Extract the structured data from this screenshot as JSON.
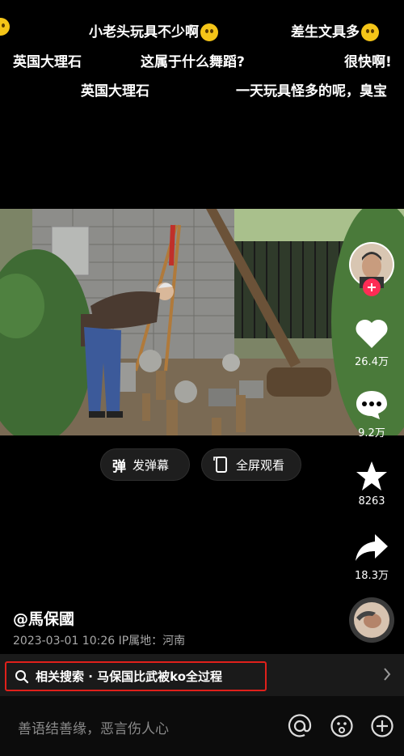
{
  "danmaku": {
    "row1_a": "小老头玩具不少啊",
    "row1_b": "差生文具多",
    "row2_a": "英国大理石",
    "row2_b": "这属于什么舞蹈?",
    "row2_c": "很快啊!",
    "row3_a": "英国大理石",
    "row3_b": "一天玩具怪多的呢，臭宝"
  },
  "side": {
    "likes": "26.4万",
    "comments": "9.2万",
    "favorites": "8263",
    "shares": "18.3万"
  },
  "actions": {
    "danmaku_label": "发弹幕",
    "danmaku_icon_char": "弹",
    "fullscreen_label": "全屏观看"
  },
  "author": {
    "name": "@馬保國",
    "meta": "2023-03-01 10:26  IP属地：河南"
  },
  "search": {
    "text": "相关搜索 · 马保国比武被ko全过程"
  },
  "comment": {
    "placeholder": "善语结善缘，恶言伤人心"
  },
  "colors": {
    "highlight_border": "#e0201b",
    "follow_plus": "#fe2c55"
  }
}
